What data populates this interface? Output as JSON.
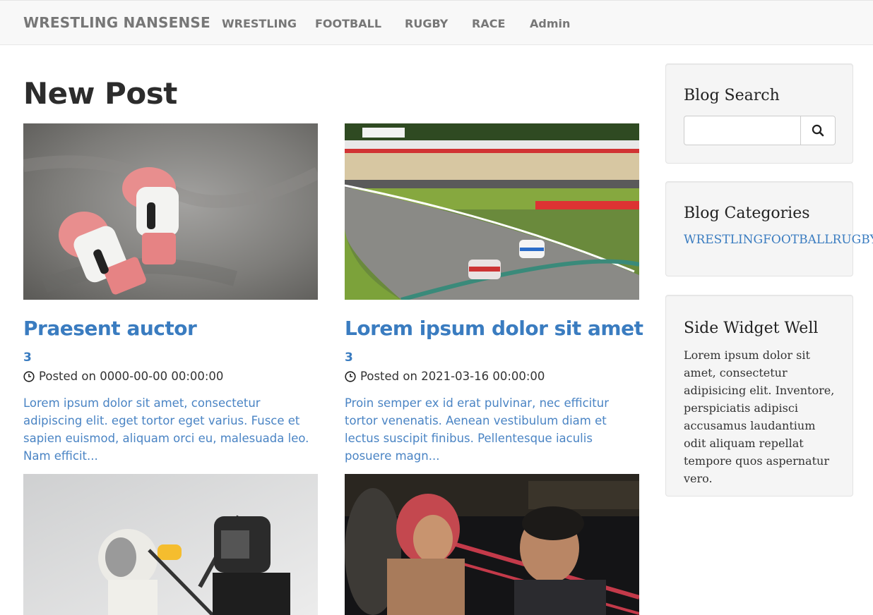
{
  "navbar": {
    "brand": "WRESTLING NANSENSE",
    "items": [
      {
        "label": "WRESTLING"
      },
      {
        "label": "FOOTBALL"
      },
      {
        "label": "RUGBY"
      },
      {
        "label": "RACE"
      },
      {
        "label": "Admin"
      }
    ]
  },
  "main": {
    "title": "New Post",
    "posts": [
      {
        "title": "Praesent auctor",
        "count": "3",
        "meta": "Posted on 0000-00-00 00:00:00",
        "excerpt": "Lorem ipsum dolor sit amet, consectetur adipiscing elit. eget tortor eget varius. Fusce et sapien euismod, aliquam orci eu, malesuada leo. Nam efficit..."
      },
      {
        "title": "Lorem ipsum dolor sit amet",
        "count": "3",
        "meta": "Posted on 2021-03-16 00:00:00",
        "excerpt": "Proin semper ex id erat pulvinar, nec efficitur tortor venenatis. Aenean vestibulum diam et lectus suscipit finibus. Pellentesque iaculis posuere magn..."
      }
    ]
  },
  "sidebar": {
    "search": {
      "title": "Blog Search",
      "value": "",
      "placeholder": ""
    },
    "categories": {
      "title": "Blog Categories",
      "items": [
        "WRESTLING",
        "FOOTBALL",
        "RUGBY"
      ]
    },
    "widget": {
      "title": "Side Widget Well",
      "text": "Lorem ipsum dolor sit amet, consectetur adipisicing elit. Inventore, perspiciatis adipisci accusamus laudantium odit aliquam repellat tempore quos aspernatur vero."
    }
  },
  "colors": {
    "link": "#3a7cc0",
    "nav_bg": "#f8f8f8",
    "well_bg": "#f5f5f5"
  },
  "icons": [
    "search-icon",
    "clock-icon"
  ]
}
